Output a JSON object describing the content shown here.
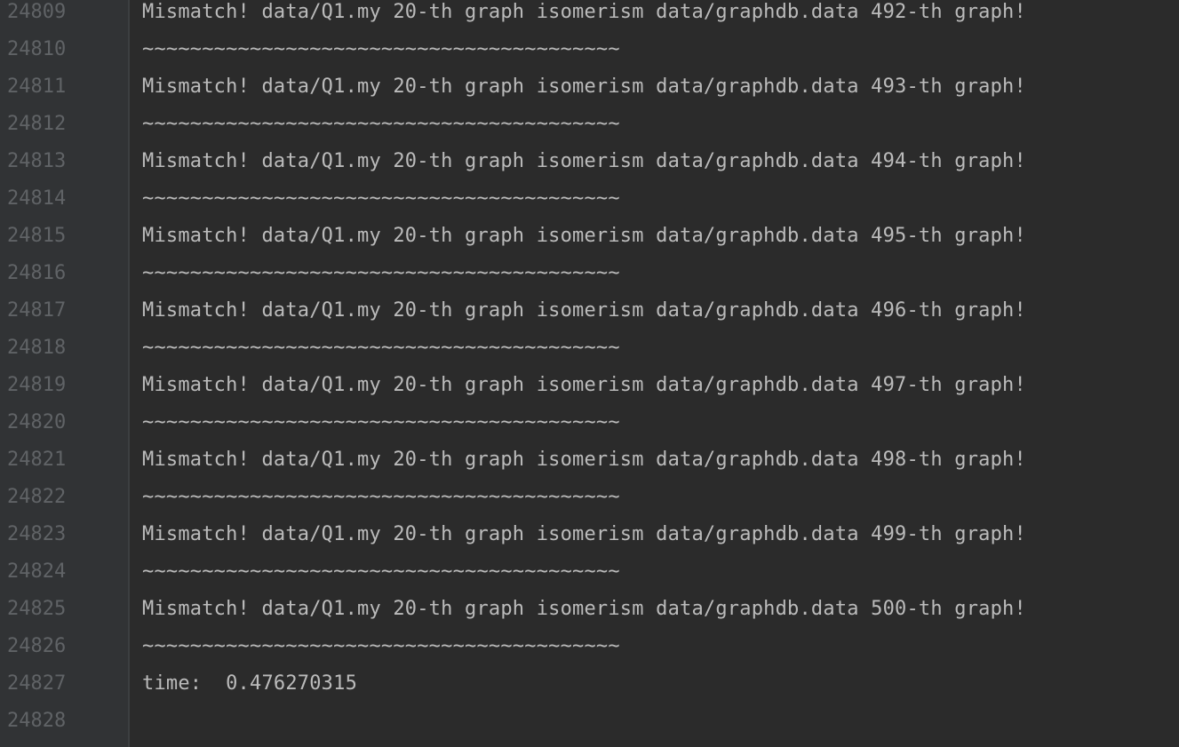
{
  "gutter": {
    "line_numbers": [
      "24809",
      "24810",
      "24811",
      "24812",
      "24813",
      "24814",
      "24815",
      "24816",
      "24817",
      "24818",
      "24819",
      "24820",
      "24821",
      "24822",
      "24823",
      "24824",
      "24825",
      "24826",
      "24827",
      "24828"
    ]
  },
  "output": {
    "lines": [
      "Mismatch! data/Q1.my 20-th graph isomerism data/graphdb.data 492-th graph!",
      "~~~~~~~~~~~~~~~~~~~~~~~~~~~~~~~~~~~~~~~~",
      "Mismatch! data/Q1.my 20-th graph isomerism data/graphdb.data 493-th graph!",
      "~~~~~~~~~~~~~~~~~~~~~~~~~~~~~~~~~~~~~~~~",
      "Mismatch! data/Q1.my 20-th graph isomerism data/graphdb.data 494-th graph!",
      "~~~~~~~~~~~~~~~~~~~~~~~~~~~~~~~~~~~~~~~~",
      "Mismatch! data/Q1.my 20-th graph isomerism data/graphdb.data 495-th graph!",
      "~~~~~~~~~~~~~~~~~~~~~~~~~~~~~~~~~~~~~~~~",
      "Mismatch! data/Q1.my 20-th graph isomerism data/graphdb.data 496-th graph!",
      "~~~~~~~~~~~~~~~~~~~~~~~~~~~~~~~~~~~~~~~~",
      "Mismatch! data/Q1.my 20-th graph isomerism data/graphdb.data 497-th graph!",
      "~~~~~~~~~~~~~~~~~~~~~~~~~~~~~~~~~~~~~~~~",
      "Mismatch! data/Q1.my 20-th graph isomerism data/graphdb.data 498-th graph!",
      "~~~~~~~~~~~~~~~~~~~~~~~~~~~~~~~~~~~~~~~~",
      "Mismatch! data/Q1.my 20-th graph isomerism data/graphdb.data 499-th graph!",
      "~~~~~~~~~~~~~~~~~~~~~~~~~~~~~~~~~~~~~~~~",
      "Mismatch! data/Q1.my 20-th graph isomerism data/graphdb.data 500-th graph!",
      "~~~~~~~~~~~~~~~~~~~~~~~~~~~~~~~~~~~~~~~~",
      "time:  0.476270315",
      ""
    ]
  },
  "colors": {
    "background": "#2b2b2b",
    "gutter_background": "#313335",
    "line_number": "#606366",
    "text": "#bbbbbb"
  }
}
